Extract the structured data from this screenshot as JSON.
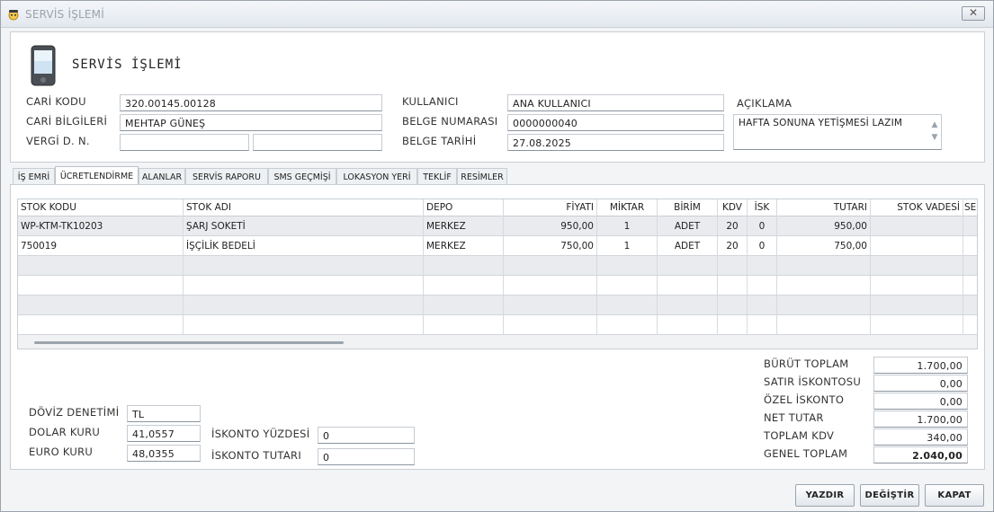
{
  "window": {
    "title": "SERVİS İŞLEMİ",
    "close_symbol": "✕"
  },
  "header": {
    "form_title": "SERVİS  İŞLEMİ",
    "cari_kodu_label": "CARİ KODU",
    "cari_kodu_value": "320.00145.00128",
    "cari_bilgileri_label": "CARİ BİLGİLERİ",
    "cari_bilgileri_value": "MEHTAP GÜNEŞ",
    "vergi_label": "VERGİ D. N.",
    "vergi_dairesi_value": "",
    "vergi_no_value": "",
    "kullanici_label": "KULLANICI",
    "kullanici_value": "ANA KULLANICI",
    "belge_no_label": "BELGE NUMARASI",
    "belge_no_value": "0000000040",
    "belge_tarihi_label": "BELGE TARİHİ",
    "belge_tarihi_value": "27.08.2025",
    "aciklama_label": "AÇIKLAMA",
    "aciklama_value": "HAFTA SONUNA YETİŞMESİ LAZIM"
  },
  "tabs": [
    {
      "label": "İŞ EMRİ",
      "active": false
    },
    {
      "label": "ÜCRETLENDİRME",
      "active": true
    },
    {
      "label": "ALANLAR",
      "active": false
    },
    {
      "label": "SERVİS RAPORU",
      "active": false
    },
    {
      "label": "SMS GEÇMİŞİ",
      "active": false
    },
    {
      "label": "LOKASYON YERİ",
      "active": false
    },
    {
      "label": "TEKLİF",
      "active": false
    },
    {
      "label": "RESİMLER",
      "active": false
    }
  ],
  "grid": {
    "columns": [
      "STOK KODU",
      "STOK ADI",
      "DEPO",
      "FİYATI",
      "MİKTAR",
      "BİRİM",
      "KDV",
      "İSK",
      "TUTARI",
      "STOK VADESİ",
      "SER"
    ],
    "rows": [
      [
        "WP-KTM-TK10203",
        "ŞARJ SOKETİ",
        "MERKEZ",
        "950,00",
        "1",
        "ADET",
        "20",
        "0",
        "950,00",
        "",
        ""
      ],
      [
        "750019",
        "İŞÇİLİK BEDELİ",
        "MERKEZ",
        "750,00",
        "1",
        "ADET",
        "20",
        "0",
        "750,00",
        "",
        ""
      ],
      [
        "",
        "",
        "",
        "",
        "",
        "",
        "",
        "",
        "",
        "",
        ""
      ],
      [
        "",
        "",
        "",
        "",
        "",
        "",
        "",
        "",
        "",
        "",
        ""
      ],
      [
        "",
        "",
        "",
        "",
        "",
        "",
        "",
        "",
        "",
        "",
        ""
      ],
      [
        "",
        "",
        "",
        "",
        "",
        "",
        "",
        "",
        "",
        "",
        ""
      ]
    ]
  },
  "footer": {
    "doviz_label": "DÖVİZ DENETİMİ",
    "doviz_value": "TL",
    "dolar_label": "DOLAR KURU",
    "dolar_value": "41,0557",
    "euro_label": "EURO KURU",
    "euro_value": "48,0355",
    "iskonto_yuzde_label": "İSKONTO YÜZDESİ",
    "iskonto_yuzde_value": "0",
    "iskonto_tutar_label": "İSKONTO  TUTARI",
    "iskonto_tutar_value": "0"
  },
  "totals": {
    "brut_label": "BÜRÜT TOPLAM",
    "brut_value": "1.700,00",
    "satir_isk_label": "SATIR İSKONTOSU",
    "satir_isk_value": "0,00",
    "ozel_isk_label": "ÖZEL İSKONTO",
    "ozel_isk_value": "0,00",
    "net_label": "NET TUTAR",
    "net_value": "1.700,00",
    "kdv_label": "TOPLAM KDV",
    "kdv_value": "340,00",
    "genel_label": "GENEL TOPLAM",
    "genel_value": "2.040,00"
  },
  "buttons": {
    "print": "YAZDIR",
    "change": "DEĞİŞTİR",
    "close": "KAPAT"
  },
  "colors": {
    "accent_border": "#8a949e",
    "alt_row": "#e9ebee"
  }
}
